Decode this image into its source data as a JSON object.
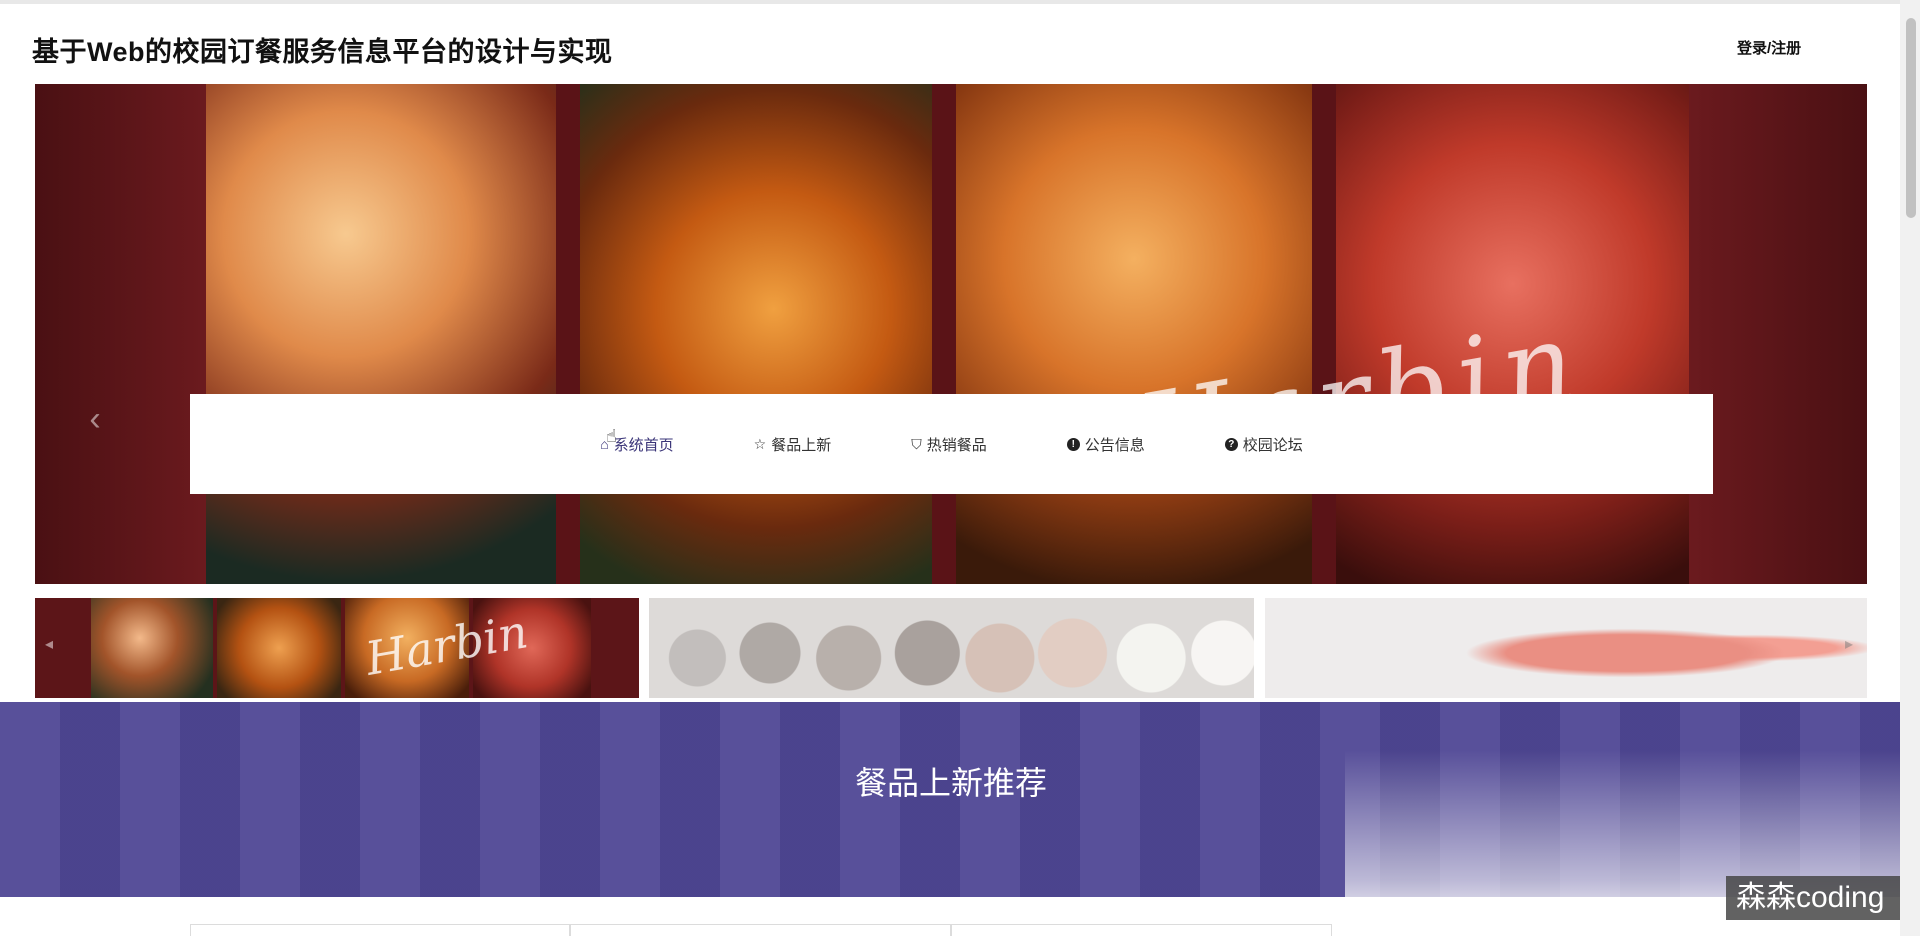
{
  "header": {
    "title": "基于Web的校园订餐服务信息平台的设计与实现",
    "auth_link": "登录/注册"
  },
  "banner": {
    "script_text": "Harbin",
    "prev_icon": "chevron-left-icon",
    "next_icon": "chevron-right-icon"
  },
  "nav": {
    "items": [
      {
        "label": "系统首页",
        "icon": "home-icon",
        "active": true
      },
      {
        "label": "餐品上新",
        "icon": "star-icon",
        "active": false
      },
      {
        "label": "热销餐品",
        "icon": "bag-icon",
        "active": false
      },
      {
        "label": "公告信息",
        "icon": "info-icon",
        "active": false
      },
      {
        "label": "校园论坛",
        "icon": "question-icon",
        "active": false
      }
    ]
  },
  "thumbnails": {
    "script_text": "Harbin"
  },
  "section": {
    "title": "餐品上新推荐"
  },
  "watermark": "森森coding",
  "colors": {
    "accent": "#4f4795",
    "banner_bg": "#5c1518",
    "active_nav": "#3a3478"
  }
}
